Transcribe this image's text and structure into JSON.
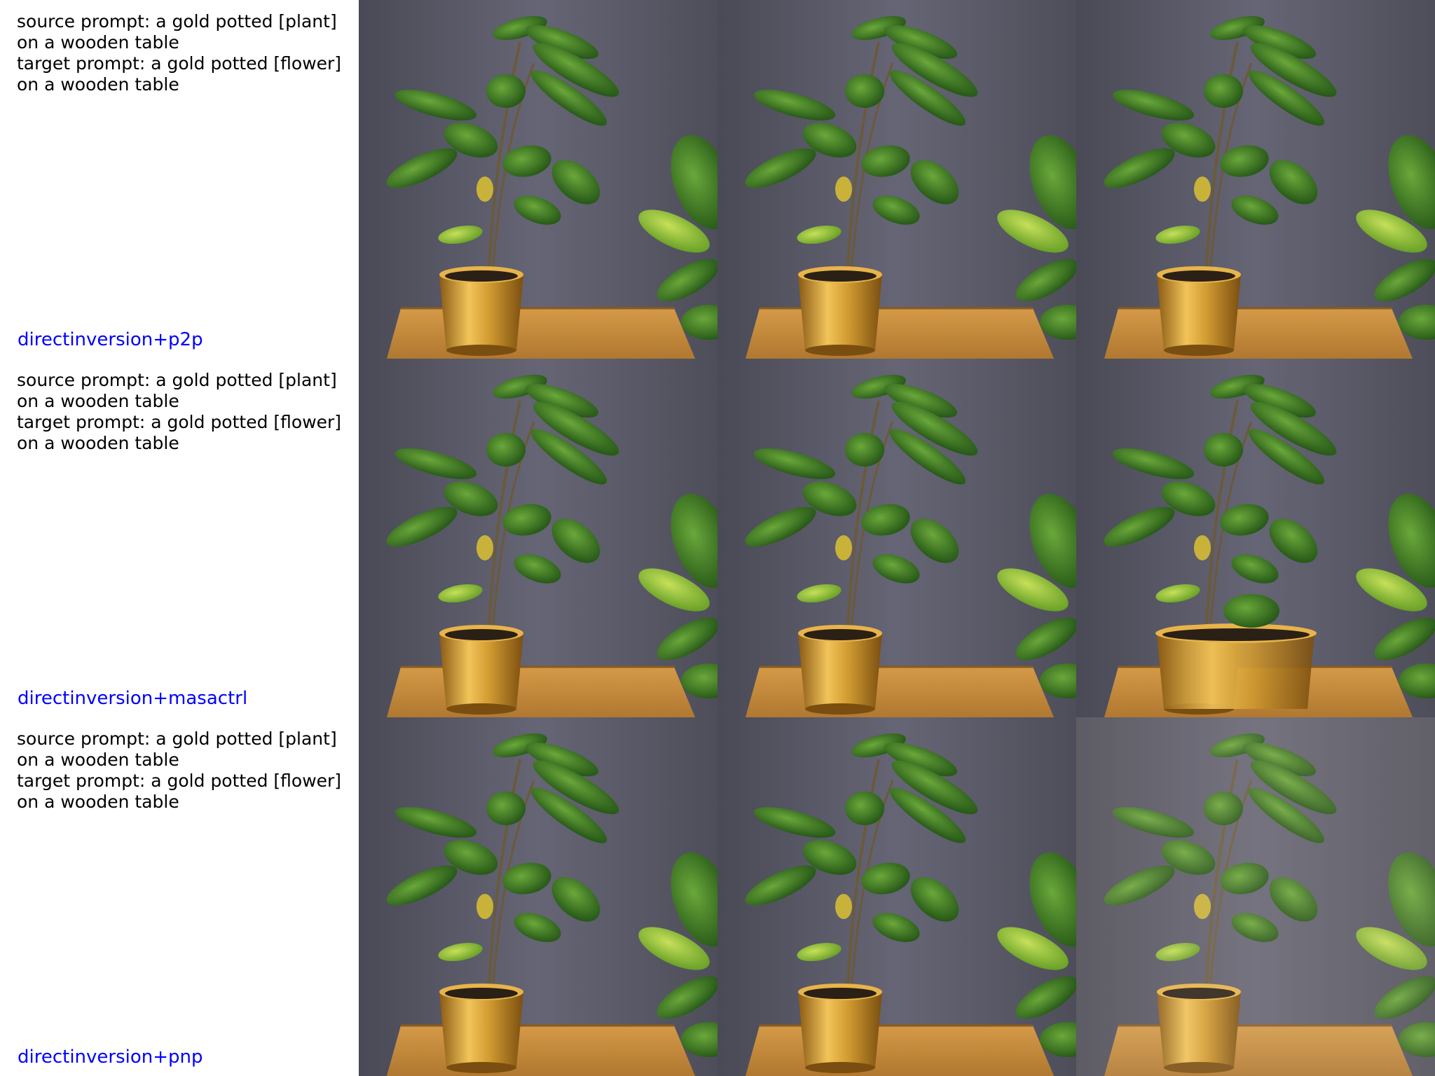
{
  "rows": [
    {
      "source_prompt": [
        "source prompt: a gold potted [plant]",
        "on a wooden table"
      ],
      "target_prompt": [
        "target prompt: a gold potted [flower]",
        "on a wooden table"
      ],
      "method": "directinversion+p2p"
    },
    {
      "source_prompt": [
        "source prompt: a gold potted [plant]",
        "on a wooden table"
      ],
      "target_prompt": [
        "target prompt: a gold potted [flower]",
        "on a wooden table"
      ],
      "method": "directinversion+masactrl"
    },
    {
      "source_prompt": [
        "source prompt: a gold potted [plant]",
        "on a wooden table"
      ],
      "target_prompt": [
        "target prompt: a gold potted [flower]",
        "on a wooden table"
      ],
      "method": "directinversion+pnp"
    }
  ],
  "colors": {
    "wall": "#5a5a66",
    "table": "#c88a3a",
    "pot": "#c9962e",
    "leaf_dark": "#2f6a1e",
    "leaf_light": "#7fb33a",
    "method_label": "#0000ff"
  }
}
